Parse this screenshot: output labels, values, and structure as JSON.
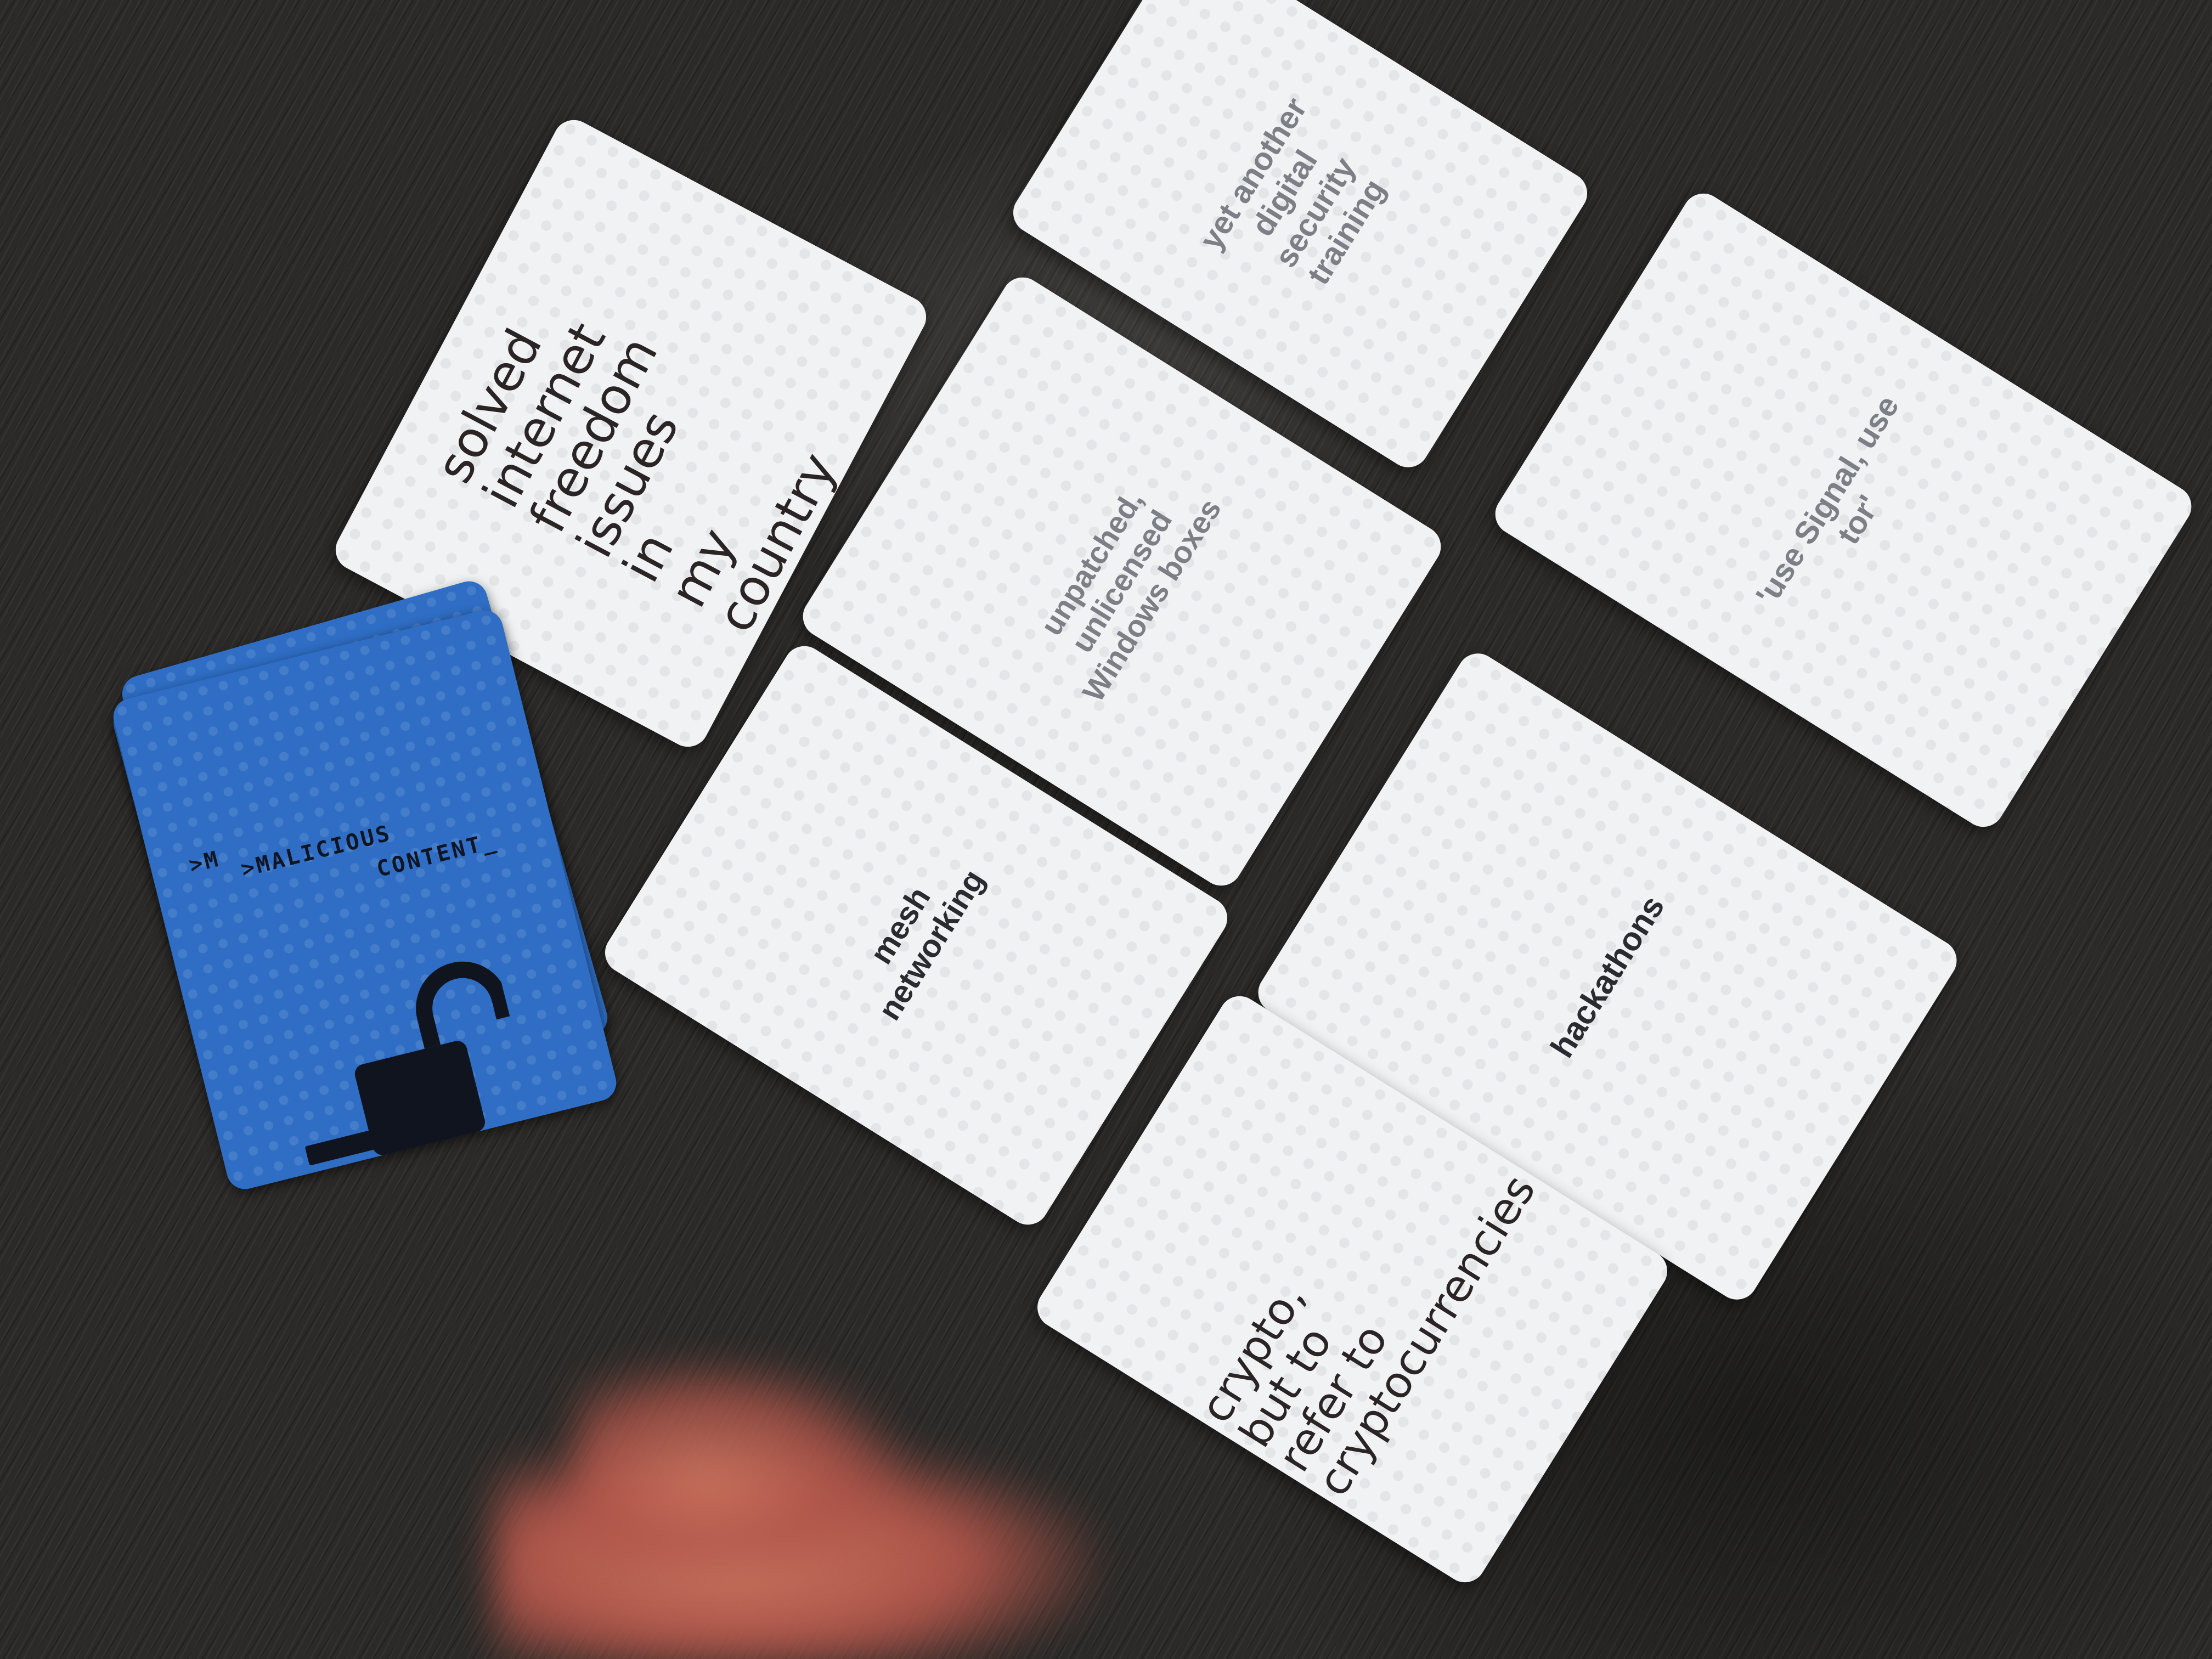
{
  "cards": {
    "training": "yet another digital\nsecurity training",
    "handwritten_top": "solved\ninternet\nfreedom\nissues in\nmy\ncountry",
    "windows": "unpatched,\nunlicensed\nWindows boxes",
    "signal": "'use Signal, use tor'",
    "mesh": "mesh networking",
    "hackathons": "hackathons",
    "crypto": "crypto,\nbut to\nrefer to\ncryptocurrencies"
  },
  "deck": {
    "prefix": ">M",
    "word1": ">MALICIOUS",
    "word2": "CONTENT_",
    "icon": "open-padlock-icon"
  },
  "colors": {
    "table": "#2b2a28",
    "card": "#f1f2f3",
    "deck": "#2f6ec4",
    "printed_text": "#7c7f86"
  }
}
